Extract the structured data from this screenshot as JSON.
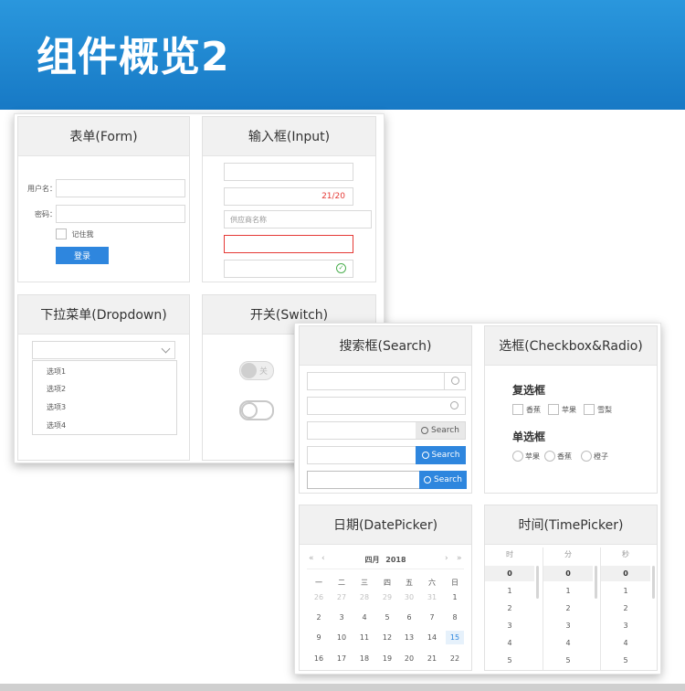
{
  "page_title": "组件概览2",
  "colors": {
    "accent": "#2e86de",
    "banner": "#1f88d3",
    "error": "#e53935",
    "success": "#4caf50"
  },
  "form": {
    "title": "表单(Form)",
    "username_label": "用户名：",
    "password_label": "密码：",
    "remember_label": "记住我",
    "login_label": "登录"
  },
  "input": {
    "title": "输入框(Input)",
    "counter": "21/20",
    "placeholder": "供应商名称"
  },
  "dropdown": {
    "title": "下拉菜单(Dropdown)",
    "options": [
      "选项1",
      "选项2",
      "选项3",
      "选项4"
    ]
  },
  "switch": {
    "title": "开关(Switch)",
    "off_label": "关"
  },
  "search": {
    "title": "搜索框(Search)",
    "button_label": "Search"
  },
  "checkbox": {
    "title": "选框(Checkbox&Radio)",
    "checkbox_heading": "复选框",
    "checkbox_items": [
      "香蕉",
      "苹果",
      "雪梨"
    ],
    "radio_heading": "单选框",
    "radio_items": [
      "苹果",
      "香蕉",
      "橙子"
    ]
  },
  "datepicker": {
    "title": "日期(DatePicker)",
    "nav_prev_year": "«",
    "nav_prev_month": "‹",
    "nav_next_month": "›",
    "nav_next_year": "»",
    "month_label": "四月",
    "year_label": "2018",
    "weekdays": [
      "一",
      "二",
      "三",
      "四",
      "五",
      "六",
      "日"
    ],
    "weeks": [
      [
        "26",
        "27",
        "28",
        "29",
        "30",
        "31",
        "1"
      ],
      [
        "2",
        "3",
        "4",
        "5",
        "6",
        "7",
        "8"
      ],
      [
        "9",
        "10",
        "11",
        "12",
        "13",
        "14",
        "15"
      ],
      [
        "16",
        "17",
        "18",
        "19",
        "20",
        "21",
        "22"
      ]
    ],
    "selected": "15"
  },
  "timepicker": {
    "title": "时间(TimePicker)",
    "columns": [
      {
        "header": "时",
        "values": [
          "0",
          "1",
          "2",
          "3",
          "4",
          "5"
        ]
      },
      {
        "header": "分",
        "values": [
          "0",
          "1",
          "2",
          "3",
          "4",
          "5"
        ]
      },
      {
        "header": "秒",
        "values": [
          "0",
          "1",
          "2",
          "3",
          "4",
          "5"
        ]
      }
    ]
  }
}
